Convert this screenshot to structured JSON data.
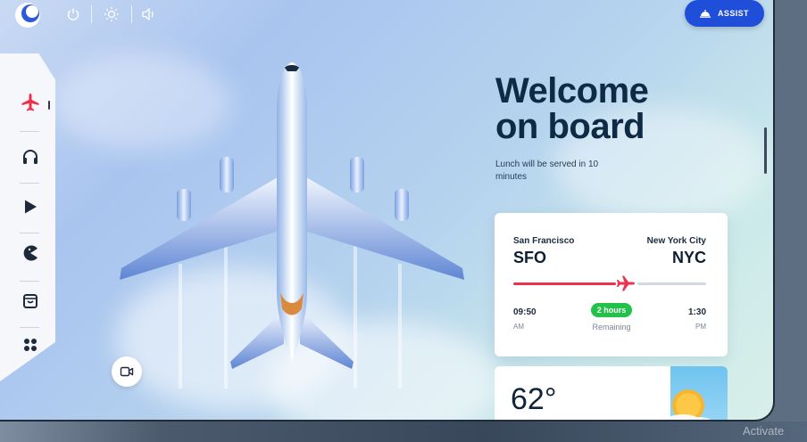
{
  "topbar": {
    "assist_label": "ASSIST"
  },
  "sidebar": {
    "items": [
      {
        "icon": "airplane-icon",
        "active": true
      },
      {
        "icon": "headphones-icon",
        "active": false
      },
      {
        "icon": "play-icon",
        "active": false
      },
      {
        "icon": "pacman-game-icon",
        "active": false
      },
      {
        "icon": "shopping-bag-icon",
        "active": false
      },
      {
        "icon": "apps-grid-icon",
        "active": false
      }
    ]
  },
  "main": {
    "headline_line1": "Welcome",
    "headline_line2": "on board",
    "subtitle": "Lunch will be served in 10 minutes"
  },
  "flight": {
    "origin_city": "San Francisco",
    "origin_code": "SFO",
    "dest_city": "New York City",
    "dest_code": "NYC",
    "depart_time": "09:50",
    "depart_ampm": "AM",
    "arrive_time": "1:30",
    "arrive_ampm": "PM",
    "duration": "2 hours",
    "remaining_label": "Remaining",
    "progress": 0.55
  },
  "weather": {
    "temperature": "62°"
  },
  "watermark": "Activate",
  "colors": {
    "accent_blue": "#1f4ed8",
    "accent_red": "#f0304f",
    "badge_green": "#22c24a",
    "headline": "#0f2a45"
  }
}
